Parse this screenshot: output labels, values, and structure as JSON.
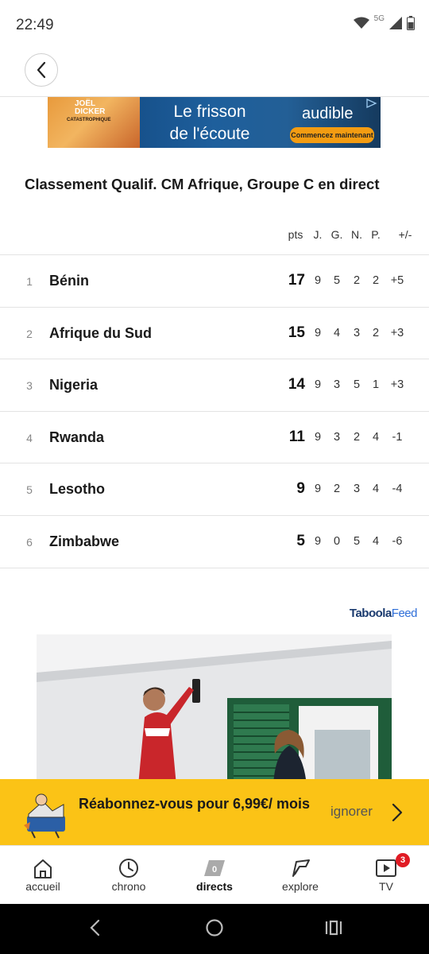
{
  "status_bar": {
    "time": "22:49",
    "network": "5G"
  },
  "ad": {
    "book_title": "JOËL DICKER",
    "book_subtitle": "CATASTROPHIQUE",
    "headline_line1": "Le frisson",
    "headline_line2": "de l'écoute",
    "brand": "audible",
    "cta": "Commencez maintenant"
  },
  "standings": {
    "title": "Classement Qualif. CM Afrique, Groupe C en direct",
    "columns": {
      "pts": "pts",
      "j": "J.",
      "g": "G.",
      "n": "N.",
      "p": "P.",
      "diff": "+/-"
    },
    "rows": [
      {
        "rank": "1",
        "team": "Bénin",
        "pts": "17",
        "j": "9",
        "g": "5",
        "n": "2",
        "p": "2",
        "diff": "+5"
      },
      {
        "rank": "2",
        "team": "Afrique du Sud",
        "pts": "15",
        "j": "9",
        "g": "4",
        "n": "3",
        "p": "2",
        "diff": "+3"
      },
      {
        "rank": "3",
        "team": "Nigeria",
        "pts": "14",
        "j": "9",
        "g": "3",
        "n": "5",
        "p": "1",
        "diff": "+3"
      },
      {
        "rank": "4",
        "team": "Rwanda",
        "pts": "11",
        "j": "9",
        "g": "3",
        "n": "2",
        "p": "4",
        "diff": "-1"
      },
      {
        "rank": "5",
        "team": "Lesotho",
        "pts": "9",
        "j": "9",
        "g": "2",
        "n": "3",
        "p": "4",
        "diff": "-4"
      },
      {
        "rank": "6",
        "team": "Zimbabwe",
        "pts": "5",
        "j": "9",
        "g": "0",
        "n": "5",
        "p": "4",
        "diff": "-6"
      }
    ]
  },
  "taboola": {
    "brand_strong": "Taboola",
    "brand_light": "Feed"
  },
  "promo": {
    "text": "Réabonnez-vous pour 6,99€/ mois",
    "ignore_label": "ignorer"
  },
  "bottom_nav": {
    "items": [
      {
        "label": "accueil",
        "icon": "home-icon"
      },
      {
        "label": "chrono",
        "icon": "clock-icon"
      },
      {
        "label": "directs",
        "icon": "live-icon",
        "active": true,
        "icon_text": "0"
      },
      {
        "label": "explore",
        "icon": "explore-icon"
      },
      {
        "label": "TV",
        "icon": "tv-icon",
        "badge": "3"
      }
    ]
  },
  "colors": {
    "promo_bg": "#fbc316",
    "badge": "#e01b24",
    "audible_cta": "#f39c12"
  }
}
